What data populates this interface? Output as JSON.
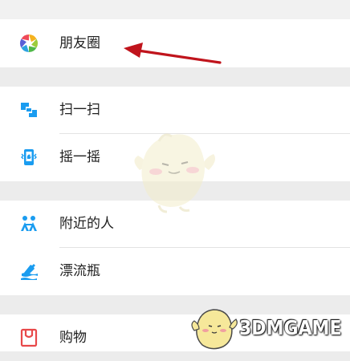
{
  "menu": {
    "moments": {
      "label": "朋友圈",
      "icon": "moments-aperture-icon"
    },
    "scan": {
      "label": "扫一扫",
      "icon": "scan-icon"
    },
    "shake": {
      "label": "摇一摇",
      "icon": "shake-phone-icon"
    },
    "nearby": {
      "label": "附近的人",
      "icon": "people-nearby-icon"
    },
    "bottle": {
      "label": "漂流瓶",
      "icon": "drift-bottle-icon"
    },
    "shopping": {
      "label": "购物",
      "icon": "shopping-bag-icon"
    }
  },
  "annotation": {
    "arrow_color": "#c0141c",
    "points_to": "moments"
  },
  "watermark": {
    "text": "3DMGAME"
  },
  "colors": {
    "background": "#ececec",
    "row": "#ffffff",
    "icon_blue": "#1a9cf0",
    "shopping_red": "#e8494a"
  }
}
